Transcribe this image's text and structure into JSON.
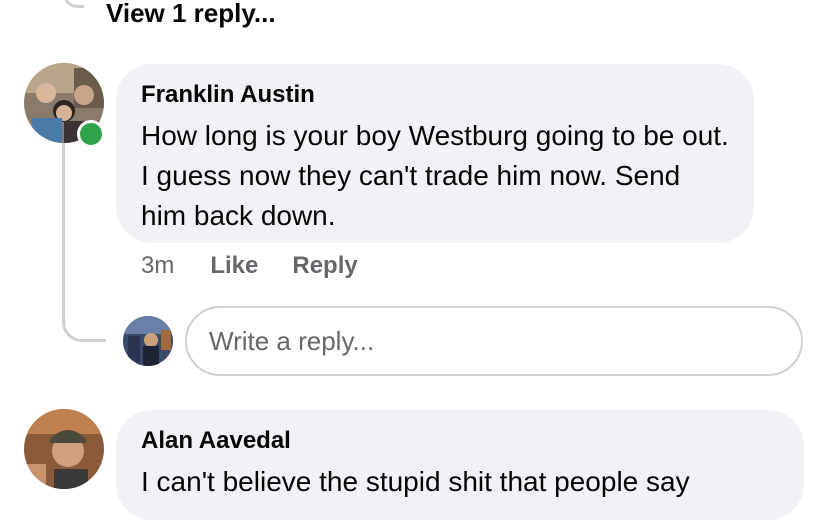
{
  "thread": {
    "view_replies_label": "View 1 reply..."
  },
  "comment_1": {
    "author": "Franklin Austin",
    "text": "How long is your boy Westburg going to be out. I guess now they can't trade him now. Send him back down.",
    "time": "3m",
    "like_label": "Like",
    "reply_label": "Reply",
    "online": true
  },
  "reply_composer": {
    "placeholder": "Write a reply..."
  },
  "comment_2": {
    "author": "Alan Aavedal",
    "text": "I can't believe the stupid shit that people say"
  },
  "colors": {
    "bubble_bg": "#f0f2f5",
    "secondary_text": "#65676b",
    "online_green": "#31a24c",
    "thread_line": "#ced0d4"
  }
}
